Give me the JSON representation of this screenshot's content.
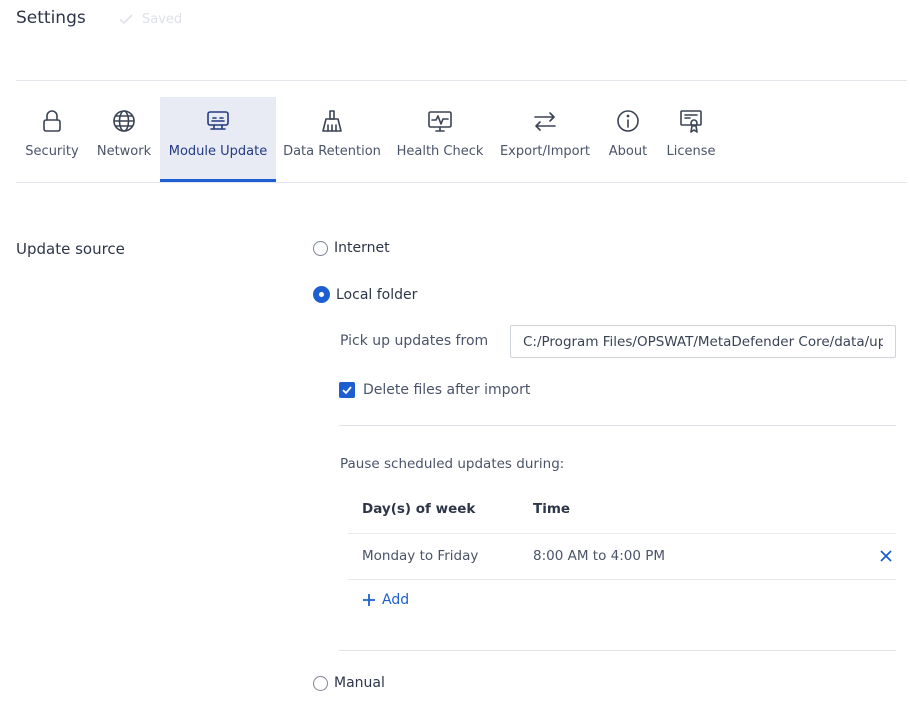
{
  "header": {
    "title": "Settings",
    "status": "Saved"
  },
  "tabs": [
    {
      "label": "Security",
      "icon": "lock-icon"
    },
    {
      "label": "Network",
      "icon": "globe-icon"
    },
    {
      "label": "Module Update",
      "icon": "module-icon",
      "active": true
    },
    {
      "label": "Data Retention",
      "icon": "broom-icon"
    },
    {
      "label": "Health Check",
      "icon": "monitor-pulse-icon"
    },
    {
      "label": "Export/Import",
      "icon": "arrows-swap-icon"
    },
    {
      "label": "About",
      "icon": "info-icon"
    },
    {
      "label": "License",
      "icon": "certificate-icon"
    }
  ],
  "update_source": {
    "label": "Update source",
    "options": {
      "internet": "Internet",
      "local": "Local folder",
      "manual": "Manual"
    },
    "selected": "Local folder",
    "local": {
      "pickup_label": "Pick up updates from",
      "pickup_value": "C:/Program Files/OPSWAT/MetaDefender Core/data/upd",
      "delete_label": "Delete files after import",
      "delete_checked": true,
      "pause_label": "Pause scheduled updates during:",
      "schedule": {
        "headers": {
          "days": "Day(s) of week",
          "time": "Time"
        },
        "rows": [
          {
            "days": "Monday to Friday",
            "time": "8:00 AM to 4:00 PM"
          }
        ],
        "add_label": "Add"
      }
    }
  },
  "colors": {
    "accent": "#1d5fd1",
    "active_tab_bg": "#e8ebf3"
  }
}
